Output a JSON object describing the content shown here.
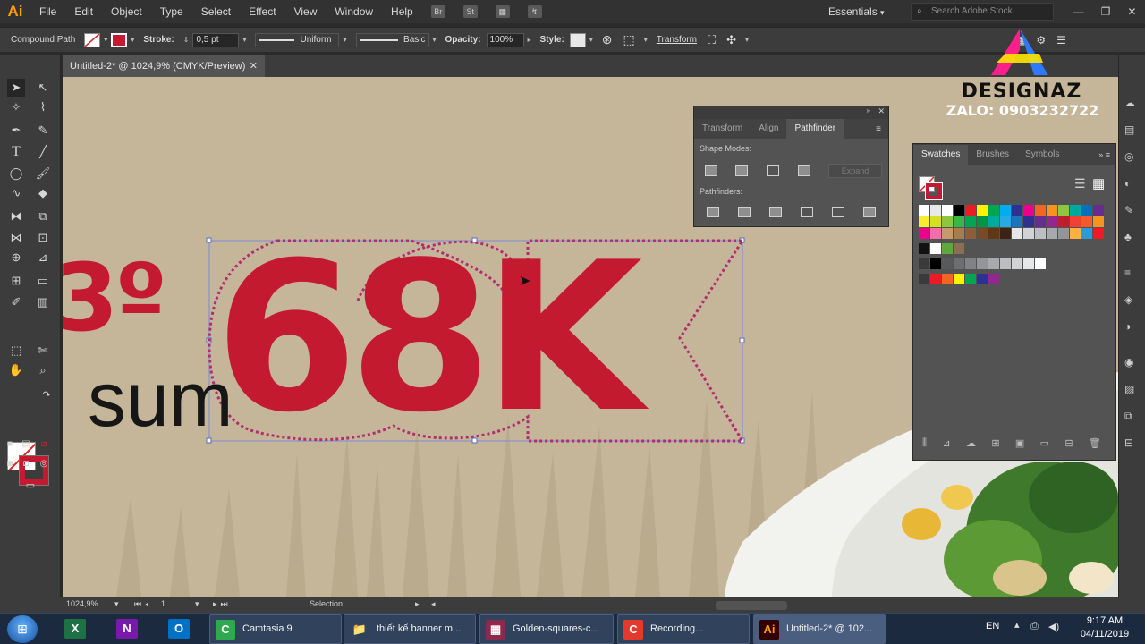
{
  "app": {
    "logo": "Ai"
  },
  "menu": [
    "File",
    "Edit",
    "Object",
    "Type",
    "Select",
    "Effect",
    "View",
    "Window",
    "Help"
  ],
  "menu_icons": {
    "bridge": "Br",
    "stock": "St"
  },
  "workspace": "Essentials",
  "search": {
    "placeholder": "Search Adobe Stock"
  },
  "window_controls": {
    "minimize": "—",
    "restore": "❐",
    "close": "✕"
  },
  "control_bar": {
    "object_type": "Compound Path",
    "stroke_label": "Stroke:",
    "stroke_value": "0,5 pt",
    "profile": "Uniform",
    "brush": "Basic",
    "opacity_label": "Opacity:",
    "opacity_value": "100%",
    "style_label": "Style:",
    "transform": "Transform"
  },
  "document": {
    "tab_title": "Untitled-2* @ 1024,9% (CMYK/Preview)",
    "close": "✕"
  },
  "artwork": {
    "left_fragment": "3º",
    "sub_fragment": "sum",
    "main_text": "68K",
    "main_color": "#c41a30",
    "bg_color": "#c5b69a"
  },
  "watermark": {
    "brand": "DESIGNAZ",
    "contact": "ZALO: 0903232722"
  },
  "pathfinder_panel": {
    "tabs": [
      "Transform",
      "Align",
      "Pathfinder"
    ],
    "active_tab": "Pathfinder",
    "shape_modes_label": "Shape Modes:",
    "expand_label": "Expand",
    "pathfinders_label": "Pathfinders:"
  },
  "swatches_panel": {
    "tabs": [
      "Swatches",
      "Brushes",
      "Symbols"
    ],
    "active_tab": "Swatches",
    "colors": [
      "#ffffff",
      "#000000",
      "#ed1c24",
      "#fff200",
      "#00a651",
      "#2e3192",
      "#ec008c",
      "#00aeef",
      "#f7941d",
      "#8dc63f",
      "#92278f",
      "#8b5e3c"
    ]
  },
  "status_bar": {
    "zoom": "1024,9%",
    "artboard": "1",
    "tool": "Selection"
  },
  "taskbar": {
    "buttons": [
      {
        "label": "Camtasia 9",
        "icon": "C"
      },
      {
        "label": "thiết kế banner m...",
        "icon": "📁"
      },
      {
        "label": "Golden-squares-c...",
        "icon": "▦"
      },
      {
        "label": "Recording...",
        "icon": "C"
      },
      {
        "label": "Untitled-2* @ 102...",
        "icon": "Ai"
      }
    ],
    "lang": "EN",
    "time": "9:17 AM",
    "date": "04/11/2019"
  }
}
